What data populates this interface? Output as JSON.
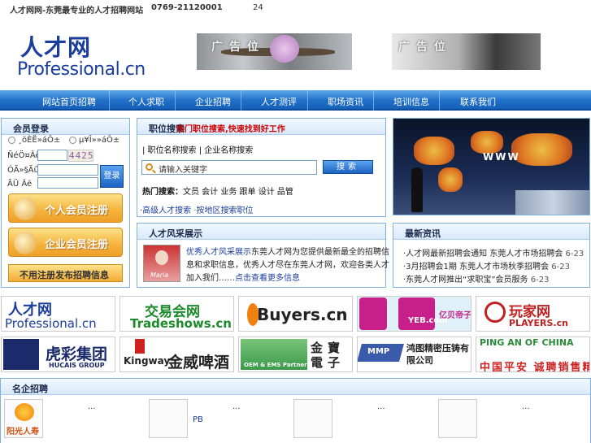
{
  "topbar": {
    "site_name": "人才网网-东莞最专业的人才招聘网站",
    "phone": "0769-21120001",
    "hours": "24"
  },
  "header": {
    "logo_cn": "人才网",
    "logo_en": "Professional.cn",
    "ad1_label": "广告位",
    "ad2_label": "广告位"
  },
  "nav": {
    "items": [
      "网站首页招聘",
      "个人求职",
      "企业招聘",
      "人才测评",
      "职场资讯",
      "培训信息",
      "联系我们"
    ]
  },
  "login": {
    "title": "会员登录",
    "radio_personal": "¸öÈË»áÔ±",
    "radio_company": "µ¥Î»»áÔ±",
    "captcha_label": "ÑéÖ¤Âë",
    "captcha_value": "4425",
    "user_label": "ÓÃ»§Ãû",
    "pass_label": "ÃÜ  Âë",
    "login_button": "登录",
    "personal_register": "个人会员注册",
    "company_register": "企业会员注册",
    "free_post": "不用注册发布招聘信息"
  },
  "search": {
    "title": "职位搜索",
    "subtitle": "热门职位搜索,快速找到好工作",
    "tabs": "| 职位名称搜索 | 企业名称搜索",
    "placeholder": "请输入关键字",
    "button": "搜索",
    "hot_label": "热门搜索：",
    "hot_items": "文员  会计  业务  跟单  设计  品管",
    "links": "·高级人才搜索  ·按地区搜索职位"
  },
  "profile": {
    "title": "人才风采展示",
    "image_name": "Maria",
    "highlight": "优秀人才风采展示",
    "text": "东莞人才网为您提供最新最全的招聘信息和求职信息，优秀人才尽在东莞人才网，欢迎各类人才加入我们……",
    "more": "点击查看更多信息"
  },
  "news": {
    "title": "最新资讯",
    "items": [
      {
        "text": "·人才网最新招聘会通知 东莞人才市场招聘会",
        "date": "6-23"
      },
      {
        "text": "·3月招聘会1期 东莞人才市场秋季招聘会",
        "date": "6-23"
      },
      {
        "text": "·东莞人才网推出“求职宝”会员服务",
        "date": "6-23"
      }
    ]
  },
  "logos": [
    {
      "name": "Professional.cn",
      "cn": "人才网"
    },
    {
      "name": "Tradeshows.cn",
      "cn": "交易会网"
    },
    {
      "name": "Buyers.cn",
      "cn": ""
    },
    {
      "name": "YEB.com",
      "cn": "亿贝帝子网"
    },
    {
      "name": "PLAYERS.cn",
      "cn": "玩家网"
    },
    {
      "name": "HUCAIS GROUP",
      "cn": "虎彩集团"
    },
    {
      "name": "Kingway",
      "cn": "金威啤酒"
    },
    {
      "name": "OEM & EMS Partner",
      "cn": "金寶電子"
    },
    {
      "name": "MMP",
      "cn": "鸿图精密压铸有限公司"
    },
    {
      "name": "PING AN OF CHINA",
      "cn": "中国平安 诚聘销售精英"
    }
  ],
  "bottom": {
    "title": "名企招聘",
    "thumb1_label": "阳光人寿",
    "dots1": "...",
    "dots2": "...",
    "pb": "PB",
    "dots3": "...",
    "dots4": "..."
  },
  "colors": {
    "nav_blue": "#1f6fc8",
    "panel_border": "#7fb0e2",
    "accent_red": "#cc0000",
    "orange": "#f4b23a"
  }
}
